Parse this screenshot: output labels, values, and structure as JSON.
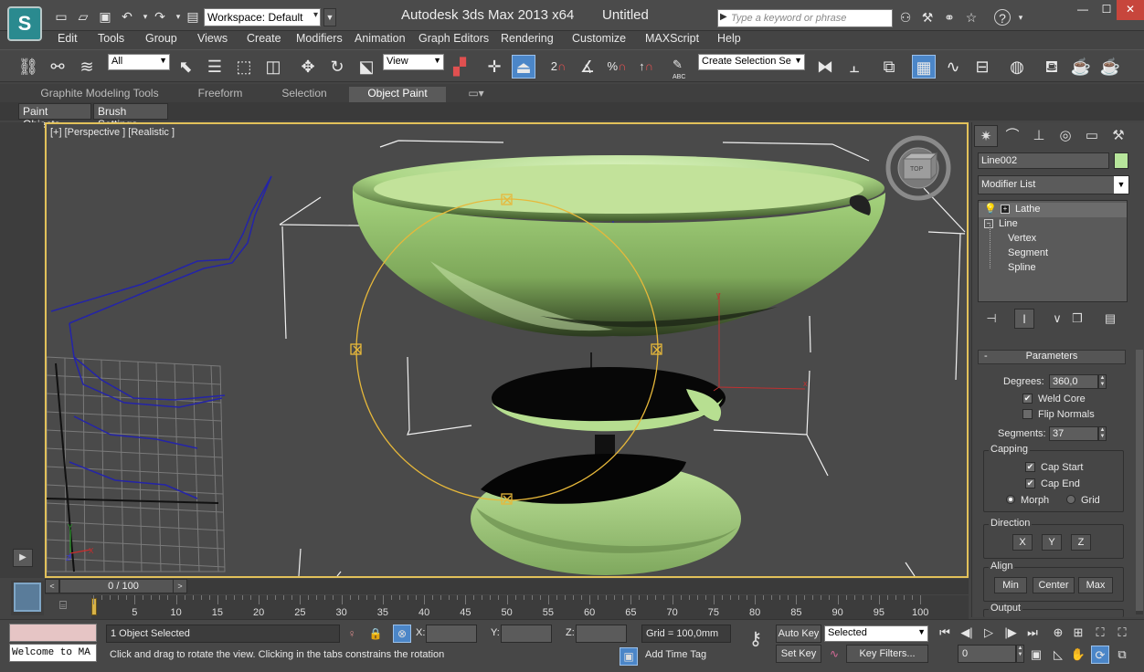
{
  "window": {
    "title": "Autodesk 3ds Max  2013 x64",
    "document": "Untitled",
    "workspace_label": "Workspace: Default",
    "search_placeholder": "Type a keyword or phrase",
    "minimize": "—",
    "maximize": "☐",
    "close": "✕",
    "logo": "S"
  },
  "menu": {
    "items": [
      "Edit",
      "Tools",
      "Group",
      "Views",
      "Create",
      "Modifiers",
      "Animation",
      "Graph Editors",
      "Rendering",
      "Customize",
      "MAXScript",
      "Help"
    ]
  },
  "toolbar": {
    "selection_filter": "All",
    "ref_coord": "View",
    "named_selection": "Create Selection Se",
    "snap_labels": [
      "2",
      "%",
      "↑"
    ],
    "abc_label": "ABC"
  },
  "ribbon": {
    "tabs": [
      "Graphite Modeling Tools",
      "Freeform",
      "Selection",
      "Object Paint"
    ],
    "active_tab": "Object Paint",
    "sub_buttons": [
      "Paint Objects",
      "Brush Settings"
    ]
  },
  "viewport": {
    "label": "[+] [Perspective ] [Realistic ]",
    "viewcube_label": "TOP",
    "accent_color": "#e2c15a",
    "object_color": "#b9dc90"
  },
  "command_panel": {
    "object_name": "Line002",
    "object_color": "#b7e59b",
    "modifier_list_label": "Modifier List",
    "stack": {
      "lathe": "Lathe",
      "line": "Line",
      "sub": [
        "Vertex",
        "Segment",
        "Spline"
      ]
    },
    "parameters": {
      "title": "Parameters",
      "degrees_label": "Degrees:",
      "degrees_value": "360,0",
      "weld_core": "Weld Core",
      "flip_normals": "Flip Normals",
      "segments_label": "Segments:",
      "segments_value": "37",
      "capping_title": "Capping",
      "cap_start": "Cap Start",
      "cap_end": "Cap End",
      "morph": "Morph",
      "grid": "Grid",
      "direction_title": "Direction",
      "dir_x": "X",
      "dir_y": "Y",
      "dir_z": "Z",
      "align_title": "Align",
      "align_min": "Min",
      "align_center": "Center",
      "align_max": "Max",
      "output_title": "Output",
      "weld_core_checked": true,
      "flip_normals_checked": false,
      "cap_start_checked": true,
      "cap_end_checked": true,
      "morph_selected": true
    }
  },
  "timeline": {
    "slider_label": "0 / 100",
    "prev": "<",
    "next": ">",
    "tick_labels": [
      "0",
      "5",
      "10",
      "15",
      "20",
      "25",
      "30",
      "35",
      "40",
      "45",
      "50",
      "55",
      "60",
      "65",
      "70",
      "75",
      "80",
      "85",
      "90",
      "95",
      "100"
    ]
  },
  "status": {
    "listener_text": "Welcome to MA",
    "selection_count": "1 Object Selected",
    "prompt": "Click and drag to rotate the view.  Clicking in the tabs constrains the rotation",
    "x_label": "X:",
    "y_label": "Y:",
    "z_label": "Z:",
    "grid": "Grid = 100,0mm",
    "add_time_tag": "Add Time Tag",
    "auto_key": "Auto Key",
    "set_key": "Set Key",
    "key_mode": "Selected",
    "key_filters": "Key Filters...",
    "frame": "0"
  }
}
